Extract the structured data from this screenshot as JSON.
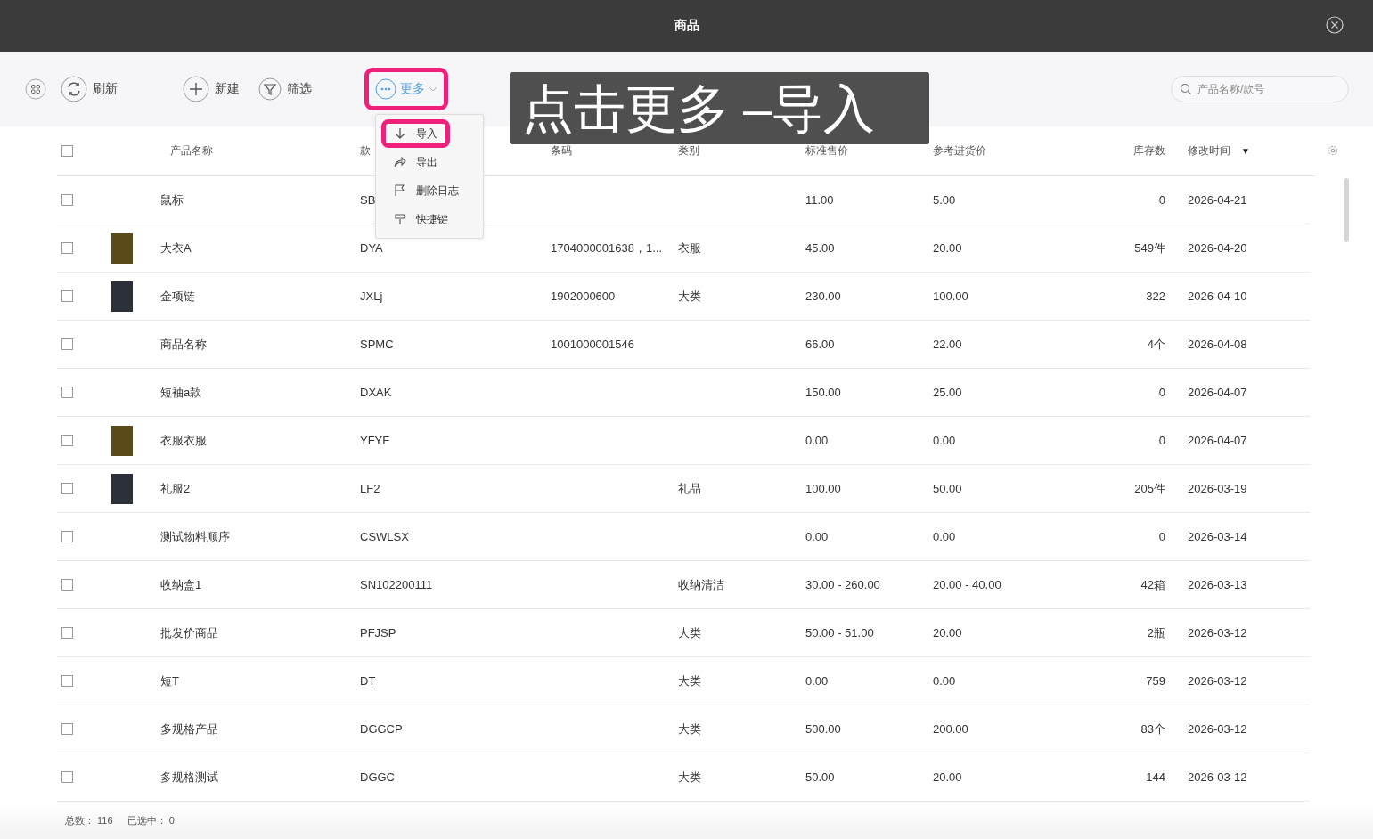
{
  "window": {
    "title": "商品"
  },
  "toolbar": {
    "buttons": [
      {
        "kind": "refresh",
        "label": "刷新",
        "highlighted": false
      },
      {
        "kind": "add",
        "label": "新建",
        "highlighted": false
      },
      {
        "kind": "filter",
        "label": "筛选",
        "highlighted": false
      },
      {
        "kind": "more",
        "label": "更多",
        "highlighted": true
      }
    ],
    "search": {
      "placeholder": "产品名称/款号"
    }
  },
  "more_menu": {
    "items": [
      {
        "kind": "import",
        "label": "导入",
        "highlighted": true
      },
      {
        "kind": "export",
        "label": "导出",
        "highlighted": false
      },
      {
        "kind": "log",
        "label": "删除日志",
        "highlighted": false
      },
      {
        "kind": "shortcut",
        "label": "快捷键",
        "highlighted": false
      }
    ]
  },
  "callout": {
    "text": "点击更多 –导入"
  },
  "table": {
    "select_all": {
      "checked": false
    },
    "columns": [
      {
        "label": "产品名称"
      },
      {
        "label": "款"
      },
      {
        "label": "条码"
      },
      {
        "label": "类别"
      },
      {
        "label": "标准售价"
      },
      {
        "label": "参考进货价"
      },
      {
        "label": "库存数"
      },
      {
        "label": "修改时间",
        "sort": "▼"
      }
    ],
    "rows": [
      {
        "checked": false,
        "photo": false,
        "cells": [
          "鼠标",
          "SB",
          "",
          "",
          "11.00",
          "5.00",
          "0",
          "2026-04-21"
        ]
      },
      {
        "checked": false,
        "photo": true,
        "cells": [
          "大衣A",
          "DYA",
          "1704000001638，1...",
          "衣服",
          "45.00",
          "20.00",
          "549件",
          "2026-04-20"
        ]
      },
      {
        "checked": false,
        "photo": true,
        "cells": [
          "金项链",
          "JXLj",
          "1902000600",
          "大类",
          "230.00",
          "100.00",
          "322",
          "2026-04-10"
        ]
      },
      {
        "checked": false,
        "photo": false,
        "cells": [
          "商品名称",
          "SPMC",
          "1001000001546",
          "",
          "66.00",
          "22.00",
          "4个",
          "2026-04-08"
        ]
      },
      {
        "checked": false,
        "photo": false,
        "cells": [
          "短袖a款",
          "DXAK",
          "",
          "",
          "150.00",
          "25.00",
          "0",
          "2026-04-07"
        ]
      },
      {
        "checked": false,
        "photo": true,
        "cells": [
          "衣服衣服",
          "YFYF",
          "",
          "",
          "0.00",
          "0.00",
          "0",
          "2026-04-07"
        ]
      },
      {
        "checked": false,
        "photo": true,
        "cells": [
          "礼服2",
          "LF2",
          "",
          "礼品",
          "100.00",
          "50.00",
          "205件",
          "2026-03-19"
        ]
      },
      {
        "checked": false,
        "photo": false,
        "cells": [
          "测试物料顺序",
          "CSWLSX",
          "",
          "",
          "0.00",
          "0.00",
          "0",
          "2026-03-14"
        ]
      },
      {
        "checked": false,
        "photo": false,
        "cells": [
          "收纳盒1",
          "SN102200111",
          "",
          "收纳清洁",
          "30.00 - 260.00",
          "20.00 - 40.00",
          "42箱",
          "2026-03-13"
        ]
      },
      {
        "checked": false,
        "photo": false,
        "cells": [
          "批发价商品",
          "PFJSP",
          "",
          "大类",
          "50.00 - 51.00",
          "20.00",
          "2瓶",
          "2026-03-12"
        ]
      },
      {
        "checked": false,
        "photo": false,
        "cells": [
          "短T",
          "DT",
          "",
          "大类",
          "0.00",
          "0.00",
          "759",
          "2026-03-12"
        ]
      },
      {
        "checked": false,
        "photo": false,
        "cells": [
          "多规格产品",
          "DGGCP",
          "",
          "大类",
          "500.00",
          "200.00",
          "83个",
          "2026-03-12"
        ]
      },
      {
        "checked": false,
        "photo": false,
        "cells": [
          "多规格测试",
          "DGGC",
          "",
          "大类",
          "50.00",
          "20.00",
          "144",
          "2026-03-12"
        ]
      }
    ]
  },
  "footer": {
    "items": [
      {
        "label": "总数：",
        "value": "116"
      },
      {
        "label": "已选中：",
        "value": "0"
      }
    ]
  }
}
